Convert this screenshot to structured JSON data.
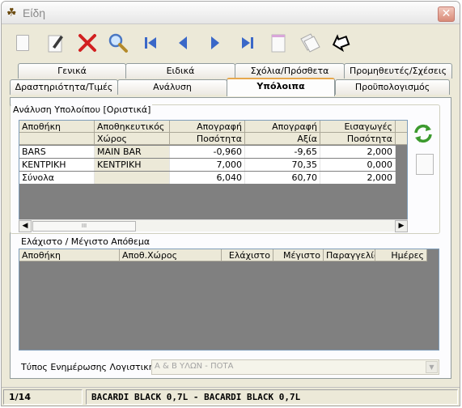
{
  "window": {
    "title": "Είδη",
    "close_glyph": "✕"
  },
  "toolbar": {
    "buttons": [
      {
        "name": "new-document-icon"
      },
      {
        "name": "edit-document-icon"
      },
      {
        "name": "delete-icon"
      },
      {
        "name": "search-icon"
      },
      {
        "name": "first-record-icon"
      },
      {
        "name": "previous-record-icon"
      },
      {
        "name": "next-record-icon"
      },
      {
        "name": "last-record-icon"
      },
      {
        "name": "notes-icon"
      },
      {
        "name": "copy-icon"
      },
      {
        "name": "exit-icon"
      }
    ]
  },
  "tabs": {
    "row1": [
      "Γενικά",
      "Ειδικά",
      "Σχόλια/Πρόσθετα",
      "Προμηθευτές/Σχέσεις"
    ],
    "row2": [
      "Δραστηριότητα/Τιμές",
      "Ανάλυση",
      "Υπόλοιπα",
      "Προϋπολογισμός"
    ],
    "active": "Υπόλοιπα"
  },
  "balance": {
    "title": "Ανάλυση Υπολοίπου [Οριστικά]",
    "header1": [
      "Αποθήκη",
      "Αποθηκευτικός",
      "Απογραφή",
      "Απογραφή",
      "Εισαγωγές"
    ],
    "header2": [
      "",
      "Χώρος",
      "Ποσότητα",
      "Αξία",
      "Ποσότητα"
    ],
    "rows": [
      [
        "BARS",
        "MAIN BAR",
        "-0,960",
        "-9,65",
        "2,000"
      ],
      [
        "ΚΕΝΤΡΙΚΗ",
        "ΚΕΝΤΡΙΚΗ",
        "7,000",
        "70,35",
        "0,000"
      ],
      [
        "Σύνολα",
        "",
        "6,040",
        "60,70",
        "2,000"
      ]
    ],
    "scroll_thumb_text": "III"
  },
  "minmax": {
    "title": "Ελάχιστο / Μέγιστο Απόθεμα",
    "headers": [
      "Αποθήκη",
      "Αποθ.Χώρος",
      "Ελάχιστο",
      "Μέγιστο",
      "Παραγγελία",
      "Ημέρες"
    ]
  },
  "footer": {
    "label": "Τύπος Ενημέρωσης Λογιστικής",
    "value": "Α & Β ΥΛΩΝ - ΠΟΤΑ"
  },
  "status": {
    "record": "1/14",
    "item": "BACARDI BLACK 0,7L - BACARDI BLACK 0,7L"
  }
}
